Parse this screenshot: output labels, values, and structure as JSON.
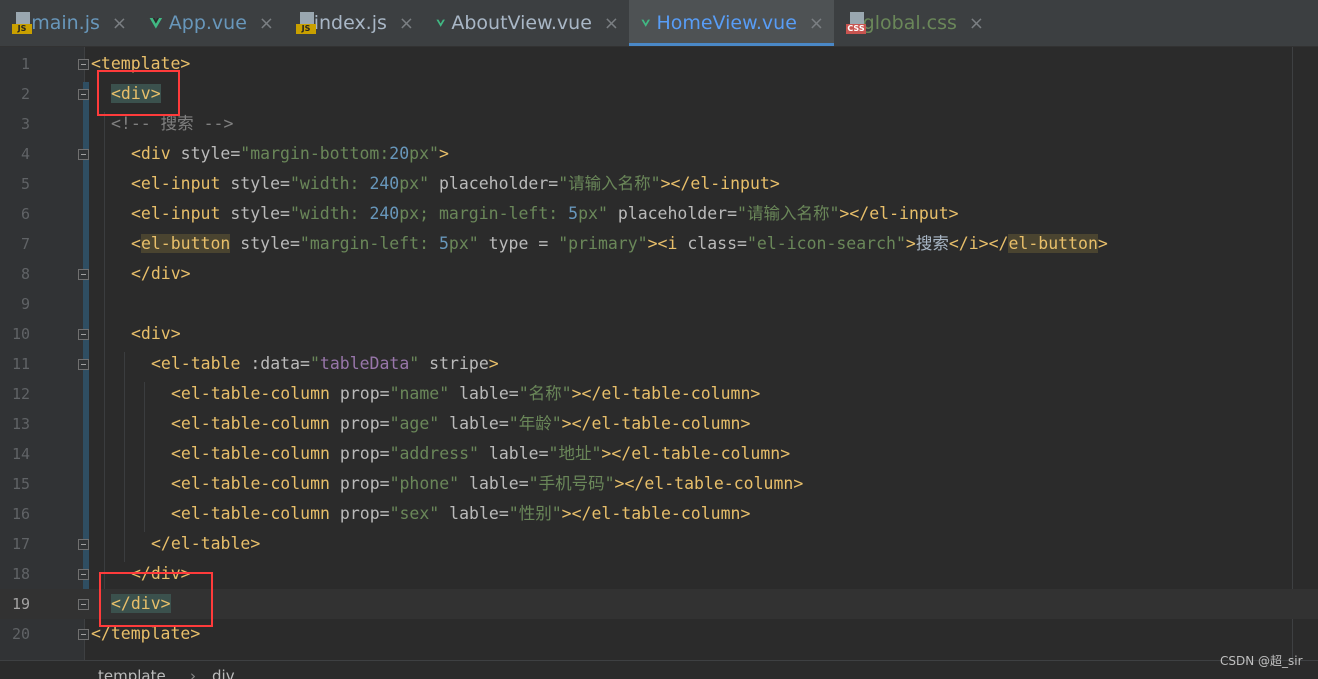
{
  "tabs": [
    {
      "label": "main.js",
      "icon": "js-file-icon",
      "active": false
    },
    {
      "label": "App.vue",
      "icon": "vue-file-icon",
      "active": false
    },
    {
      "label": "index.js",
      "icon": "js-file-icon",
      "active": false
    },
    {
      "label": "AboutView.vue",
      "icon": "vue-file-icon",
      "active": false
    },
    {
      "label": "HomeView.vue",
      "icon": "vue-file-icon",
      "active": true
    },
    {
      "label": "global.css",
      "icon": "css-file-icon",
      "active": false
    }
  ],
  "tab_close_glyph": "×",
  "icon_badges": {
    "js": "JS",
    "css": "CSS"
  },
  "line_numbers": [
    "1",
    "2",
    "3",
    "4",
    "5",
    "6",
    "7",
    "8",
    "9",
    "10",
    "11",
    "12",
    "13",
    "14",
    "15",
    "16",
    "17",
    "18",
    "19",
    "20"
  ],
  "code": {
    "l1_tag": "<template>",
    "l2_tag": "<div>",
    "l3_comment": "<!-- 搜索 -->",
    "l4_open": "<div ",
    "l4_attr": "style=",
    "l4_s1": "\"margin-bottom:",
    "l4_num": "20",
    "l4_s2": "px\"",
    "l4_close": ">",
    "l5_open": "<el-input ",
    "l5_attr1": "style=",
    "l5_s1": "\"width: ",
    "l5_num": "240",
    "l5_s2": "px\"",
    "l5_attr2": " placeholder=",
    "l5_s3": "\"请输入名称\"",
    "l5_close": "></el-input>",
    "l6_open": "<el-input ",
    "l6_attr1": "style=",
    "l6_s1": "\"width: ",
    "l6_num1": "240",
    "l6_s2": "px; margin-left: ",
    "l6_num2": "5",
    "l6_s3": "px\"",
    "l6_attr2": " placeholder=",
    "l6_s4": "\"请输入名称\"",
    "l6_close": "></el-input>",
    "l7_lt": "<",
    "l7_tag": "el-button",
    "l7_attr1": " style=",
    "l7_s1": "\"margin-left: ",
    "l7_num": "5",
    "l7_s2": "px\"",
    "l7_attr2": " type = ",
    "l7_s3": "\"primary\"",
    "l7_i_open": "><i ",
    "l7_attr3": "class=",
    "l7_s4": "\"el-icon-search\"",
    "l7_gt": ">",
    "l7_text": "搜索",
    "l7_i_close": "</i></",
    "l7_tag_end": "el-button",
    "l7_end": ">",
    "l8_tag": "</div>",
    "l10_tag": "<div>",
    "l11_open": "<el-table ",
    "l11_attr1": ":data=",
    "l11_q1": "\"",
    "l11_var": "tableData",
    "l11_q2": "\"",
    "l11_attr2": " stripe",
    "l11_close": ">",
    "col_open": "<el-table-column ",
    "col_prop": "prop=",
    "col_lable": " lable=",
    "col_close": "></el-table-column>",
    "cols": [
      {
        "prop": "\"name\"",
        "lable": "\"名称\""
      },
      {
        "prop": "\"age\"",
        "lable": "\"年龄\""
      },
      {
        "prop": "\"address\"",
        "lable": "\"地址\""
      },
      {
        "prop": "\"phone\"",
        "lable": "\"手机号码\""
      },
      {
        "prop": "\"sex\"",
        "lable": "\"性别\""
      }
    ],
    "l17_tag": "</el-table>",
    "l18_tag": "</div>",
    "l19_tag": "</div>",
    "l20_tag": "</template>"
  },
  "breadcrumb": {
    "item1": "template",
    "sep": "›",
    "item2": "div"
  },
  "watermark": "CSDN @超_sir",
  "colors": {
    "tag": "#e8bf6a",
    "string": "#6a8759",
    "number": "#6897bb",
    "comment": "#808080",
    "highlight_box": "#ff3b3b"
  }
}
